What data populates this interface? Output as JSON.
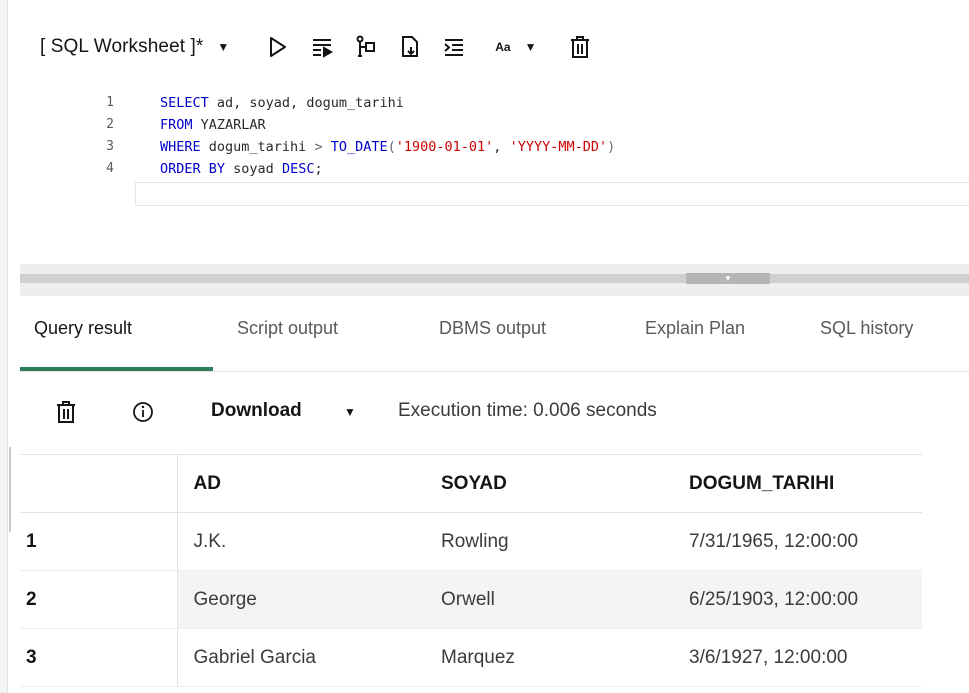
{
  "toolbar": {
    "worksheet_title": "[ SQL Worksheet ]*",
    "font_size_label": "Aa",
    "icons": [
      "run-statement-icon",
      "run-script-icon",
      "explain-plan-icon",
      "save-file-icon",
      "format-icon",
      "clear-icon"
    ]
  },
  "editor": {
    "lines": [
      {
        "num": "1",
        "text": "SELECT ad, soyad, dogum_tarihi"
      },
      {
        "num": "2",
        "text": "FROM YAZARLAR"
      },
      {
        "num": "3",
        "text": "WHERE dogum_tarihi > TO_DATE('1900-01-01', 'YYYY-MM-DD')"
      },
      {
        "num": "4",
        "text": "ORDER BY soyad DESC;"
      }
    ],
    "tokens": {
      "l1_kw": "SELECT",
      "l1_rest": " ad, soyad, dogum_tarihi",
      "l2_kw": "FROM",
      "l2_rest": " YAZARLAR",
      "l3_kw": "WHERE",
      "l3_col": " dogum_tarihi ",
      "l3_op": ">",
      "l3_fn": " TO_DATE",
      "l3_p1": "(",
      "l3_s1": "'1900-01-01'",
      "l3_comma": ", ",
      "l3_s2": "'YYYY-MM-DD'",
      "l3_p2": ")",
      "l4_kw1": "ORDER BY",
      "l4_mid": " soyad ",
      "l4_kw2": "DESC",
      "l4_end": ";"
    }
  },
  "tabs": [
    "Query result",
    "Script output",
    "DBMS output",
    "Explain Plan",
    "SQL history"
  ],
  "active_tab": "Query result",
  "result_toolbar": {
    "download_label": "Download",
    "execution_time": "Execution time: 0.006 seconds"
  },
  "table": {
    "columns": [
      "AD",
      "SOYAD",
      "DOGUM_TARIHI"
    ],
    "rows": [
      {
        "n": "1",
        "ad": "J.K.",
        "soyad": "Rowling",
        "dogum": "7/31/1965, 12:00:00"
      },
      {
        "n": "2",
        "ad": "George",
        "soyad": "Orwell",
        "dogum": "6/25/1903, 12:00:00"
      },
      {
        "n": "3",
        "ad": "Gabriel Garcia",
        "soyad": "Marquez",
        "dogum": "3/6/1927, 12:00:00"
      }
    ]
  },
  "colors": {
    "keyword": "#0000cc",
    "string": "#cc0000",
    "active_tab_underline": "#2e7d5b"
  }
}
